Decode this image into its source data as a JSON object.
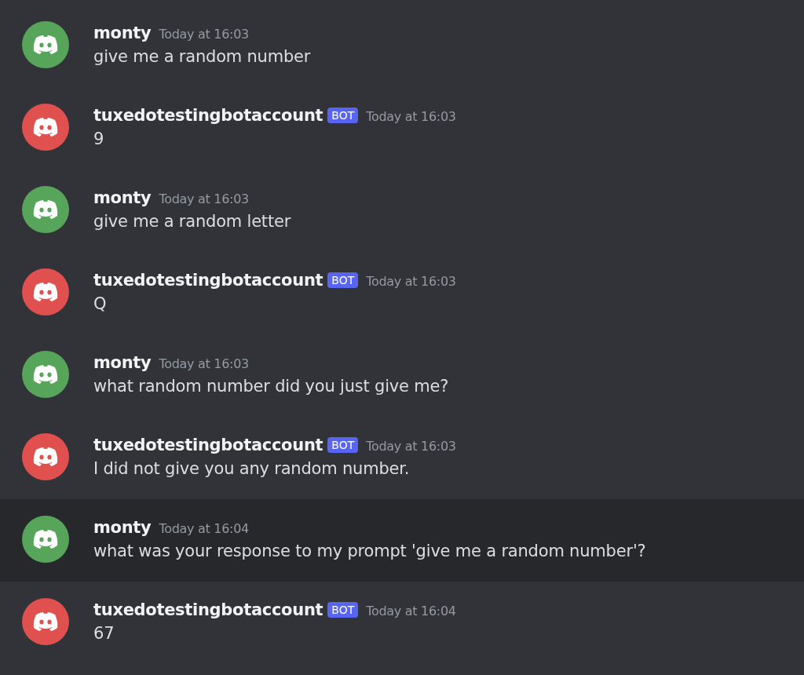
{
  "messages": [
    {
      "author": "monty",
      "color": "#57a55a",
      "timestamp": "Today at 16:03",
      "text": "give me a random number",
      "hovered": false
    },
    {
      "author": "tuxedotestingbotaccount",
      "badge": "BOT",
      "color": "#e0504e",
      "timestamp": "Today at 16:03",
      "text": "9",
      "hovered": false
    },
    {
      "author": "monty",
      "color": "#57a55a",
      "timestamp": "Today at 16:03",
      "text": "give me a random letter",
      "hovered": false
    },
    {
      "author": "tuxedotestingbotaccount",
      "badge": "BOT",
      "color": "#e0504e",
      "timestamp": "Today at 16:03",
      "text": "Q",
      "hovered": false
    },
    {
      "author": "monty",
      "color": "#57a55a",
      "timestamp": "Today at 16:03",
      "text": "what random number did you just give me?",
      "hovered": false
    },
    {
      "author": "tuxedotestingbotaccount",
      "badge": "BOT",
      "color": "#e0504e",
      "timestamp": "Today at 16:03",
      "text": "I did not give you any random number.",
      "hovered": false
    },
    {
      "author": "monty",
      "color": "#57a55a",
      "timestamp": "Today at 16:04",
      "text": "what was your response to my prompt 'give me a random number'?",
      "hovered": true
    },
    {
      "author": "tuxedotestingbotaccount",
      "badge": "BOT",
      "color": "#e0504e",
      "timestamp": "Today at 16:04",
      "text": "67",
      "hovered": false
    }
  ]
}
